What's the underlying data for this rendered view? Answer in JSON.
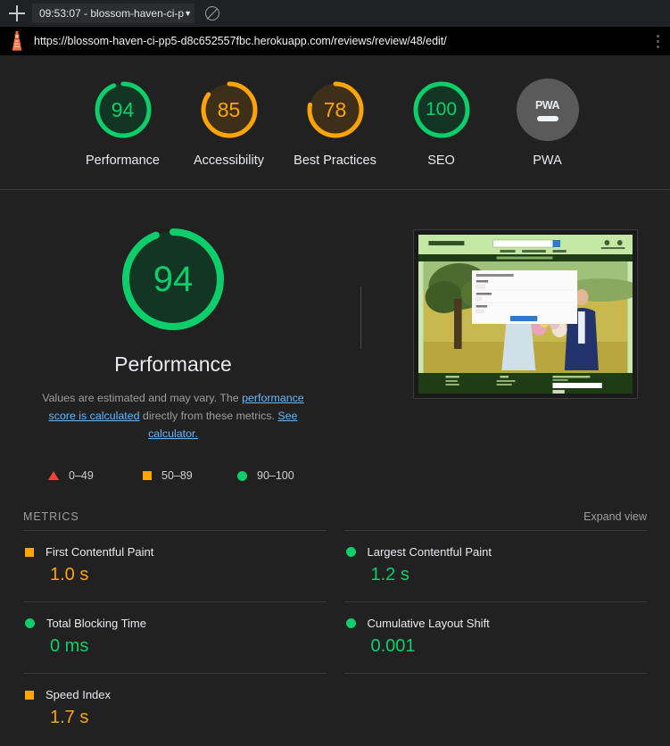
{
  "browser": {
    "new_tab_icon": "plus-icon",
    "tab_label": "09:53:07 - blossom-haven-ci-p",
    "tab_caret": "▼",
    "clear_icon": "no-entry-icon",
    "url": "https://blossom-haven-ci-pp5-d8c652557fbc.herokuapp.com/reviews/review/48/edit/",
    "brand_icon": "lighthouse-icon",
    "menu_icon": "kebab-menu-icon"
  },
  "category_gauges": [
    {
      "label": "Performance",
      "score": "94",
      "value": 94,
      "tone": "green",
      "color": "#0cce6b",
      "track": "#123524"
    },
    {
      "label": "Accessibility",
      "score": "85",
      "value": 85,
      "tone": "orange",
      "color": "#ffa400",
      "track": "#3e3018"
    },
    {
      "label": "Best Practices",
      "score": "78",
      "value": 78,
      "tone": "orange",
      "color": "#ffa400",
      "track": "#3e3018"
    },
    {
      "label": "SEO",
      "score": "100",
      "value": 100,
      "tone": "green",
      "color": "#0cce6b",
      "track": "#123524"
    },
    {
      "label": "PWA",
      "score": "PWA",
      "value": null,
      "tone": "gray",
      "color": "#5a5a5a",
      "track": "#5a5a5a"
    }
  ],
  "performance": {
    "score": "94",
    "value": 94,
    "title": "Performance",
    "color": "#0cce6b",
    "track": "#123524",
    "description_pre": "Values are estimated and may vary. The ",
    "link_1": "performance score is calculated",
    "description_mid": " directly from these metrics. ",
    "link_2": "See calculator."
  },
  "legend": [
    {
      "marker": "triangle",
      "range": "0–49",
      "color": "#f44336"
    },
    {
      "marker": "square",
      "range": "50–89",
      "color": "#ffa400"
    },
    {
      "marker": "circle",
      "range": "90–100",
      "color": "#0cce6b"
    }
  ],
  "metrics_section": {
    "title": "METRICS",
    "expand_label": "Expand view",
    "items": [
      {
        "name": "First Contentful Paint",
        "value": "1.0 s",
        "marker": "square",
        "tone": "orange"
      },
      {
        "name": "Largest Contentful Paint",
        "value": "1.2 s",
        "marker": "circle",
        "tone": "green"
      },
      {
        "name": "Total Blocking Time",
        "value": "0 ms",
        "marker": "circle",
        "tone": "green"
      },
      {
        "name": "Cumulative Layout Shift",
        "value": "0.001",
        "marker": "circle",
        "tone": "green"
      },
      {
        "name": "Speed Index",
        "value": "1.7 s",
        "marker": "square",
        "tone": "orange"
      }
    ]
  },
  "screenshot_preview": {
    "site_name": "BLOSSOM HAVEN",
    "banner_text": "FREE DELIVERY ON ORDERS OVER £50",
    "alt": "page screenshot thumbnail of wedding florist site"
  }
}
